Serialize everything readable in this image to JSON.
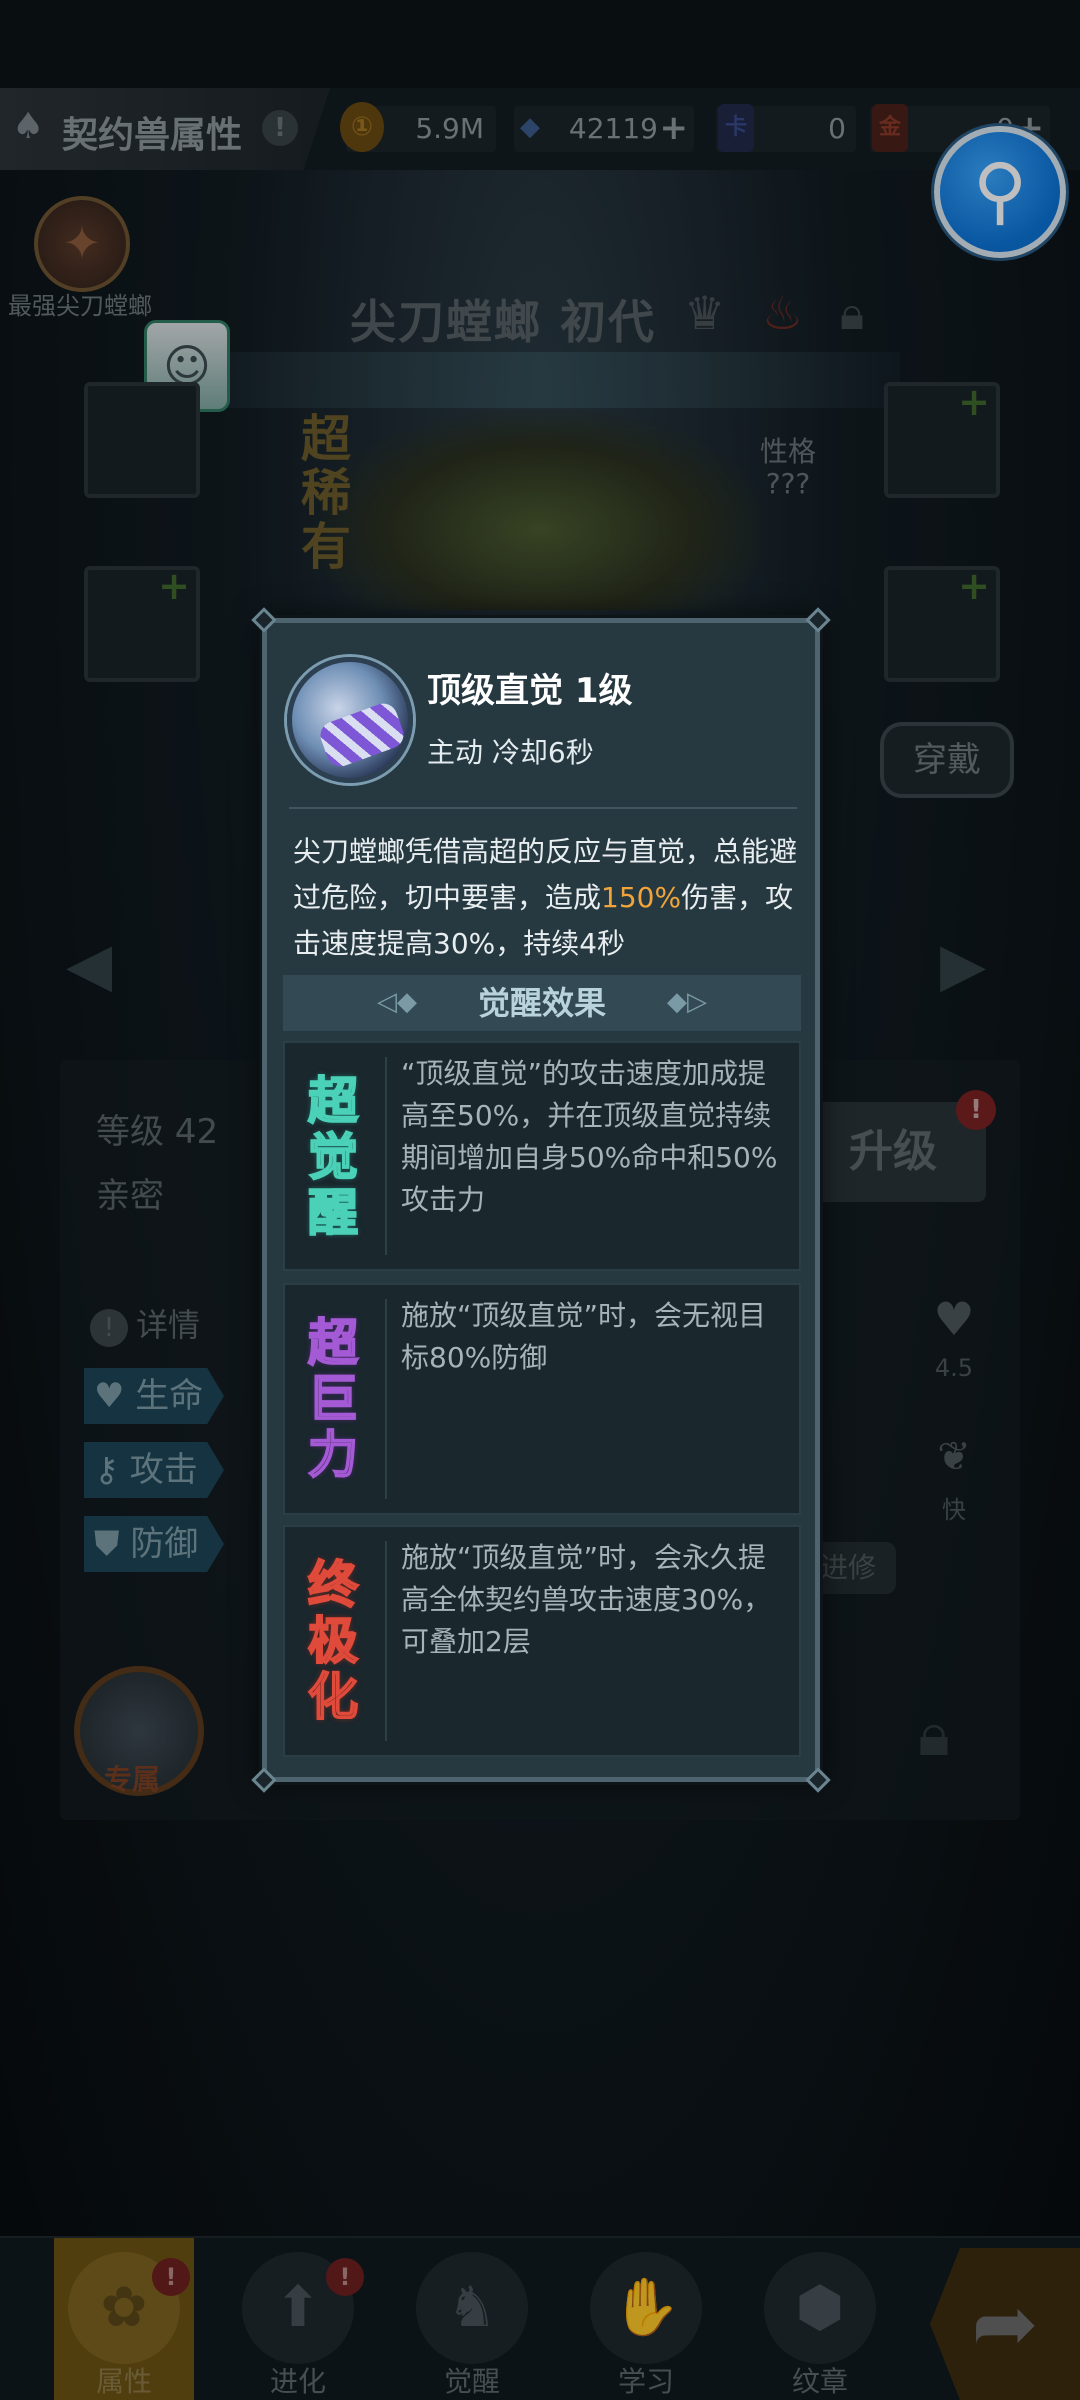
{
  "topbar": {
    "title": "契约兽属性",
    "gold": "5.9M",
    "gems": "42119",
    "card_count": "0",
    "gold_ticket_count": "0",
    "gold_icon_glyph": "①",
    "gem_icon_glyph": "◆",
    "card_icon_glyph": "卡",
    "gold_ticket_icon_glyph": "金"
  },
  "scene": {
    "medal_label": "最强尖刀螳螂",
    "monster_name": "尖刀螳螂 初代",
    "rarity": "超稀有",
    "trait_label": "性格",
    "trait_value": "???",
    "equip_button": "穿戴",
    "level_text": "等级 42",
    "intimacy_text": "亲密",
    "upgrade_button": "升级",
    "detail_label": "详情",
    "attr_hp": "生命",
    "attr_atk": "攻击",
    "attr_def": "防御",
    "heart_value": "4.5",
    "speed_value": "快",
    "train_label": "进修",
    "exclusive_label": "专属"
  },
  "popup": {
    "skill_name": "顶级直觉 1级",
    "skill_meta": "主动  冷却6秒",
    "desc_part1": "尖刀螳螂凭借高超的反应与直觉，总能避过危险，切中要害，造成",
    "desc_highlight": "150%",
    "desc_part2": "伤害，攻击速度提高30%，持续4秒",
    "awakening_header": "觉醒效果",
    "effects": [
      {
        "emblem": "超觉醒",
        "text": "“顶级直觉”的攻击速度加成提高至50%，并在顶级直觉持续期间增加自身50%命中和50%攻击力"
      },
      {
        "emblem": "超巨力",
        "text": "施放“顶级直觉”时，会无视目标80%防御"
      },
      {
        "emblem": "终极化",
        "text": "施放“顶级直觉”时，会永久提高全体契约兽攻击速度30%，可叠加2层"
      }
    ]
  },
  "bottom_nav": [
    {
      "label": "属性",
      "badge": "!",
      "active": true
    },
    {
      "label": "进化",
      "badge": "!"
    },
    {
      "label": "觉醒"
    },
    {
      "label": "学习"
    },
    {
      "label": "纹章"
    }
  ],
  "colors": {
    "highlight": "#f0a43a",
    "magnifier": "#1a8cf0",
    "popup_bg": "#263840"
  },
  "icons": {
    "magnifier": "magnifier-icon",
    "lock": "lock-icon",
    "fire": "fire-icon",
    "helmet": "helmet-icon",
    "heart": "heart-icon",
    "speed": "wing-icon"
  }
}
